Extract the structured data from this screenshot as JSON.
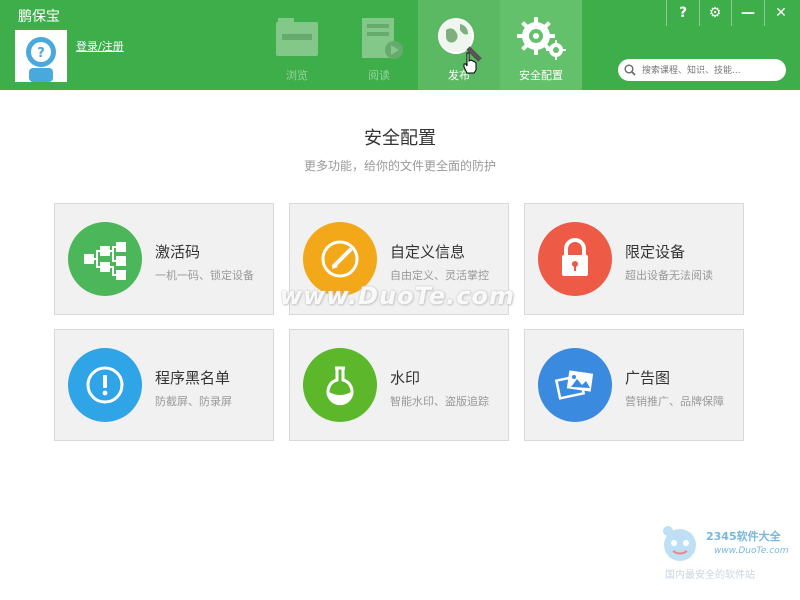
{
  "app": {
    "title": "鹏保宝",
    "login_text": "登录/注册"
  },
  "nav": {
    "tabs": [
      {
        "label": "浏览",
        "icon": "folder-icon"
      },
      {
        "label": "阅读",
        "icon": "reader-icon"
      },
      {
        "label": "发布",
        "icon": "globe-search-icon"
      },
      {
        "label": "安全配置",
        "icon": "gears-icon"
      }
    ],
    "active": "安全配置"
  },
  "window_controls": {
    "help": "?",
    "settings": "⚙",
    "minimize": "—",
    "close": "✕"
  },
  "search": {
    "placeholder": "搜索课程、知识、技能..."
  },
  "main": {
    "title": "安全配置",
    "subtitle": "更多功能，给你的文件更全面的防护",
    "cards": [
      {
        "title": "激活码",
        "desc": "一机一码、锁定设备",
        "icon": "network-icon",
        "color": "#4cb75a"
      },
      {
        "title": "自定义信息",
        "desc": "自由定义、灵活掌控",
        "icon": "edit-icon",
        "color": "#f2a819"
      },
      {
        "title": "限定设备",
        "desc": "超出设备无法阅读",
        "icon": "lock-icon",
        "color": "#ed5a46"
      },
      {
        "title": "程序黑名单",
        "desc": "防截屏、防录屏",
        "icon": "alert-icon",
        "color": "#2fa4e6"
      },
      {
        "title": "水印",
        "desc": "智能水印、盗版追踪",
        "icon": "flask-icon",
        "color": "#5cb82a"
      },
      {
        "title": "广告图",
        "desc": "营销推广、品牌保障",
        "icon": "images-icon",
        "color": "#3a8be0"
      }
    ]
  },
  "watermarks": {
    "duote": "www.DuoTe.com",
    "brand": "2345软件大全",
    "brand_url": "www.DuoTe.com",
    "slogan": "国内最安全的软件站"
  }
}
